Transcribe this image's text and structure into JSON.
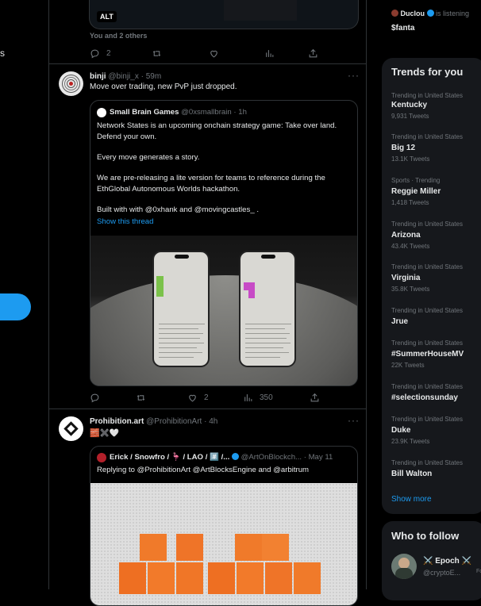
{
  "left_nav": {
    "partial_text": "s"
  },
  "feed": {
    "prev_tweet": {
      "alt_label": "ALT",
      "likers_text": "You and 2 others",
      "reply_count": "2",
      "retweet_count": "",
      "like_count": ""
    },
    "tweet1": {
      "author_name": "binji",
      "author_handle": "@binji_x",
      "time": "· 59m",
      "text": "Move over trading, new PvP just dropped.",
      "quote": {
        "author_name": "Small Brain Games",
        "author_handle": "@0xsmallbrain",
        "time": "· 1h",
        "para1": "Network States is an upcoming onchain strategy game: Take over land. Defend your own.",
        "para2": "Every move generates a story.",
        "para3": "We are pre-releasing a lite version for teams to reference during the EthGlobal Autonomous Worlds hackathon.",
        "para4": "Built with with @0xhank and @movingcastles_ .",
        "show_thread": "Show this thread"
      },
      "reply_count": "",
      "retweet_count": "",
      "like_count": "2",
      "view_count": "350"
    },
    "tweet2": {
      "author_name": "Prohibition.art",
      "author_handle": "@ProhibitionArt",
      "time": "· 4h",
      "text": "🧱✖️🤍",
      "quote": {
        "author_name": "Erick / Snowfro / 🦩 / LAO / #️⃣ /...",
        "author_handle": "@ArtOnBlockch...",
        "time": "· May 11",
        "replying_to": "Replying to @ProhibitionArt @ArtBlocksEngine and @arbitrum"
      }
    }
  },
  "sidebar": {
    "listening": {
      "name": "Duclou",
      "status": "is listening",
      "space_title": "$fanta"
    },
    "trends": {
      "title": "Trends for you",
      "items": [
        {
          "context": "Trending in United States",
          "name": "Kentucky",
          "count": "9,931 Tweets"
        },
        {
          "context": "Trending in United States",
          "name": "Big 12",
          "count": "13.1K Tweets"
        },
        {
          "context": "Sports · Trending",
          "name": "Reggie Miller",
          "count": "1,418 Tweets"
        },
        {
          "context": "Trending in United States",
          "name": "Arizona",
          "count": "43.4K Tweets"
        },
        {
          "context": "Trending in United States",
          "name": "Virginia",
          "count": "35.8K Tweets"
        },
        {
          "context": "Trending in United States",
          "name": "Jrue",
          "count": ""
        },
        {
          "context": "Trending in United States",
          "name": "#SummerHouseMV",
          "count": "22K Tweets"
        },
        {
          "context": "Trending in United States",
          "name": "#selectionsunday",
          "count": ""
        },
        {
          "context": "Trending in United States",
          "name": "Duke",
          "count": "23.9K Tweets"
        },
        {
          "context": "Trending in United States",
          "name": "Bill Walton",
          "count": ""
        }
      ],
      "show_more": "Show more"
    },
    "who_to_follow": {
      "title": "Who to follow",
      "user_name": "⚔️ Epoch ⚔️",
      "user_handle": "@cryptoE...",
      "follow_partial": "Fo"
    }
  },
  "colors": {
    "accent": "#1d9bf0",
    "background": "#000000",
    "panel": "#16181c",
    "border": "#2f3336",
    "muted": "#71767b"
  }
}
